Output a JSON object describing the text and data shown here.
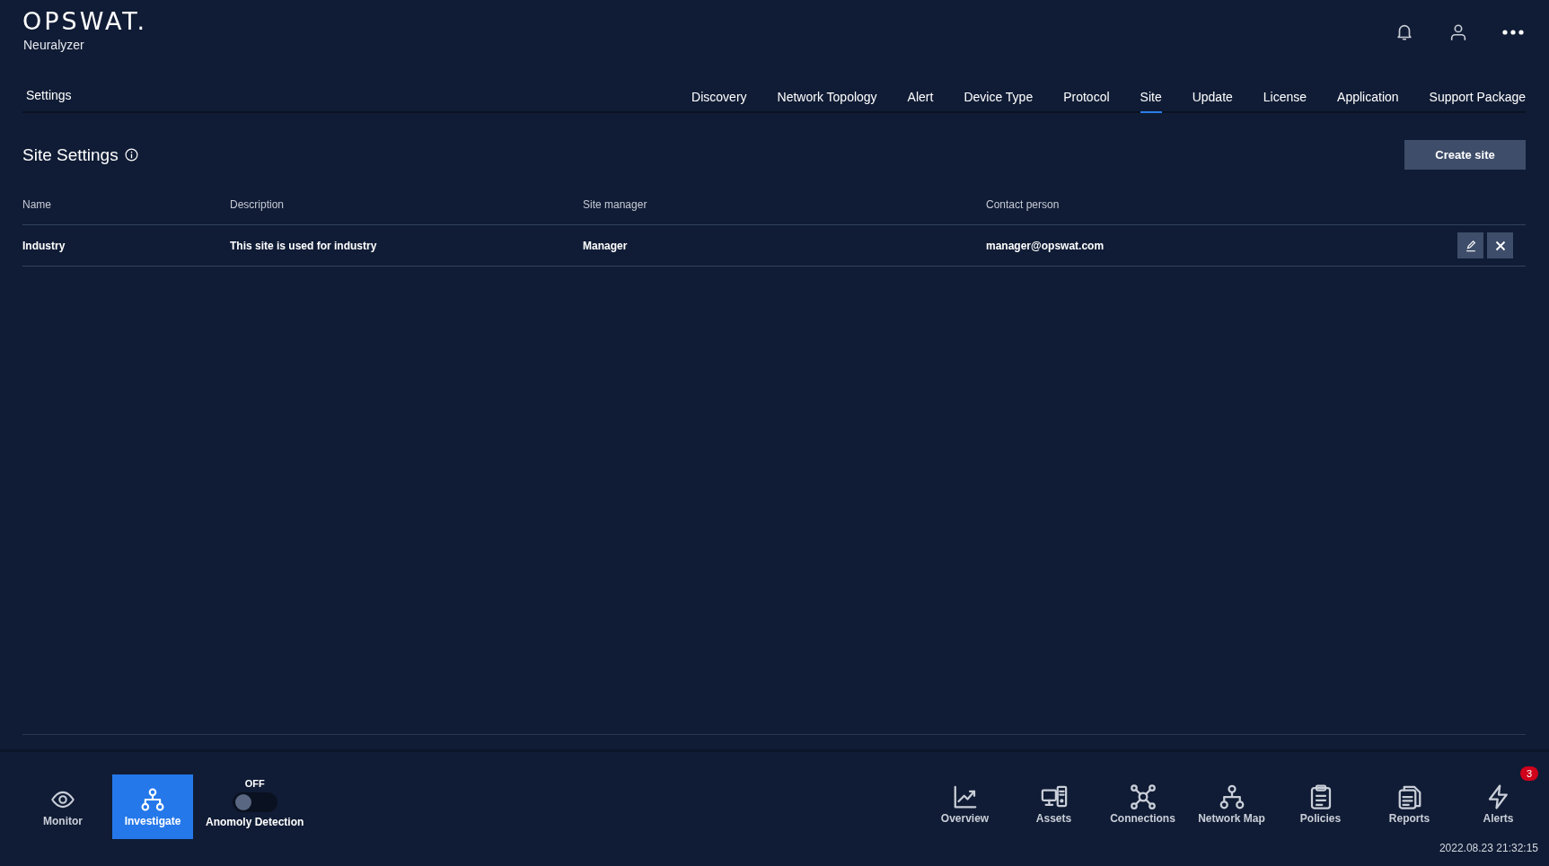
{
  "header": {
    "logo": "OPSWAT.",
    "product": "Neuralyzer"
  },
  "nav": {
    "title": "Settings",
    "tabs": [
      {
        "label": "Discovery",
        "selected": false
      },
      {
        "label": "Network Topology",
        "selected": false
      },
      {
        "label": "Alert",
        "selected": false
      },
      {
        "label": "Device Type",
        "selected": false
      },
      {
        "label": "Protocol",
        "selected": false
      },
      {
        "label": "Site",
        "selected": true
      },
      {
        "label": "Update",
        "selected": false
      },
      {
        "label": "License",
        "selected": false
      },
      {
        "label": "Application",
        "selected": false
      },
      {
        "label": "Support Package",
        "selected": false
      }
    ]
  },
  "section": {
    "title": "Site Settings",
    "button": "Create site"
  },
  "table": {
    "columns": [
      "Name",
      "Description",
      "Site manager",
      "Contact person"
    ],
    "rows": [
      {
        "cells": [
          "Industry",
          "This site is used for industry",
          "Manager",
          "manager@opswat.com"
        ]
      }
    ]
  },
  "footer": {
    "modes": [
      {
        "label": "Monitor",
        "selected": false
      },
      {
        "label": "Investigate",
        "selected": true
      }
    ],
    "toggle": {
      "state_text": "OFF",
      "label": "Anomoly Detection",
      "on": false
    },
    "apps": [
      {
        "label": "Overview"
      },
      {
        "label": "Assets"
      },
      {
        "label": "Connections"
      },
      {
        "label": "Network Map"
      },
      {
        "label": "Policies"
      },
      {
        "label": "Reports"
      },
      {
        "label": "Alerts",
        "badge": "3"
      }
    ],
    "timestamp": "2022.08.23 21:32:15"
  }
}
